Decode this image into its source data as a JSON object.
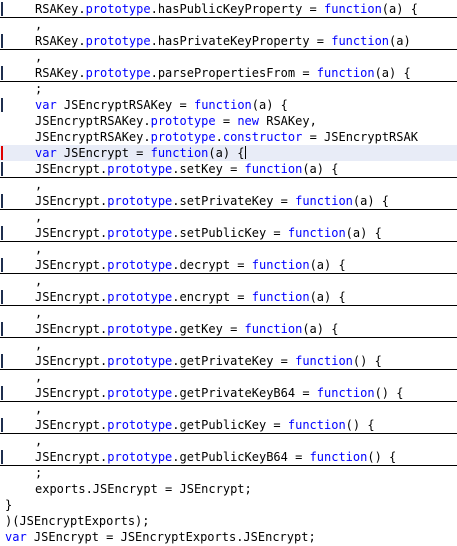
{
  "editor": {
    "lines": [
      {
        "indent": 4,
        "fold": true,
        "gutter": "blue",
        "tokens": [
          {
            "t": "RSAKey.",
            "k": "pl"
          },
          {
            "t": "prototype",
            "k": "kw"
          },
          {
            "t": ".hasPublicKeyProperty = ",
            "k": "pl"
          },
          {
            "t": "function",
            "k": "kw"
          },
          {
            "t": "(a) {",
            "k": "pl"
          }
        ]
      },
      {
        "indent": 4,
        "fold": false,
        "gutter": "",
        "tokens": [
          {
            "t": ",",
            "k": "pl"
          }
        ]
      },
      {
        "indent": 4,
        "fold": true,
        "gutter": "blue",
        "tokens": [
          {
            "t": "RSAKey.",
            "k": "pl"
          },
          {
            "t": "prototype",
            "k": "kw"
          },
          {
            "t": ".hasPrivateKeyProperty = ",
            "k": "pl"
          },
          {
            "t": "function",
            "k": "kw"
          },
          {
            "t": "(a)",
            "k": "pl"
          }
        ]
      },
      {
        "indent": 4,
        "fold": false,
        "gutter": "",
        "tokens": [
          {
            "t": ",",
            "k": "pl"
          }
        ]
      },
      {
        "indent": 4,
        "fold": true,
        "gutter": "blue",
        "tokens": [
          {
            "t": "RSAKey.",
            "k": "pl"
          },
          {
            "t": "prototype",
            "k": "kw"
          },
          {
            "t": ".parsePropertiesFrom = ",
            "k": "pl"
          },
          {
            "t": "function",
            "k": "kw"
          },
          {
            "t": "(a) {",
            "k": "pl"
          }
        ]
      },
      {
        "indent": 4,
        "fold": false,
        "gutter": "",
        "tokens": [
          {
            "t": ";",
            "k": "pl"
          }
        ]
      },
      {
        "indent": 4,
        "fold": false,
        "gutter": "blue",
        "tokens": [
          {
            "t": "var",
            "k": "kw"
          },
          {
            "t": " JSEncryptRSAKey = ",
            "k": "pl"
          },
          {
            "t": "function",
            "k": "kw"
          },
          {
            "t": "(a) {",
            "k": "pl"
          }
        ]
      },
      {
        "indent": 4,
        "fold": false,
        "gutter": "",
        "tokens": [
          {
            "t": "JSEncryptRSAKey.",
            "k": "pl"
          },
          {
            "t": "prototype",
            "k": "kw"
          },
          {
            "t": " = ",
            "k": "pl"
          },
          {
            "t": "new",
            "k": "kw"
          },
          {
            "t": " RSAKey,",
            "k": "pl"
          }
        ]
      },
      {
        "indent": 4,
        "fold": false,
        "gutter": "",
        "tokens": [
          {
            "t": "JSEncryptRSAKey.",
            "k": "pl"
          },
          {
            "t": "prototype",
            "k": "kw"
          },
          {
            "t": ".",
            "k": "pl"
          },
          {
            "t": "constructor",
            "k": "kw"
          },
          {
            "t": " = JSEncryptRSAK",
            "k": "pl"
          }
        ]
      },
      {
        "indent": 4,
        "fold": false,
        "gutter": "red",
        "current": true,
        "tokens": [
          {
            "t": "var",
            "k": "kw"
          },
          {
            "t": " JSEncrypt = ",
            "k": "pl"
          },
          {
            "t": "function",
            "k": "kw"
          },
          {
            "t": "(a) {",
            "k": "pl"
          }
        ]
      },
      {
        "indent": 4,
        "fold": true,
        "gutter": "blue",
        "tokens": [
          {
            "t": "JSEncrypt.",
            "k": "pl"
          },
          {
            "t": "prototype",
            "k": "kw"
          },
          {
            "t": ".setKey = ",
            "k": "pl"
          },
          {
            "t": "function",
            "k": "kw"
          },
          {
            "t": "(a) {",
            "k": "pl"
          }
        ]
      },
      {
        "indent": 4,
        "fold": false,
        "gutter": "",
        "tokens": [
          {
            "t": ",",
            "k": "pl"
          }
        ]
      },
      {
        "indent": 4,
        "fold": true,
        "gutter": "blue",
        "tokens": [
          {
            "t": "JSEncrypt.",
            "k": "pl"
          },
          {
            "t": "prototype",
            "k": "kw"
          },
          {
            "t": ".setPrivateKey = ",
            "k": "pl"
          },
          {
            "t": "function",
            "k": "kw"
          },
          {
            "t": "(a) {",
            "k": "pl"
          }
        ]
      },
      {
        "indent": 4,
        "fold": false,
        "gutter": "",
        "tokens": [
          {
            "t": ",",
            "k": "pl"
          }
        ]
      },
      {
        "indent": 4,
        "fold": true,
        "gutter": "blue",
        "tokens": [
          {
            "t": "JSEncrypt.",
            "k": "pl"
          },
          {
            "t": "prototype",
            "k": "kw"
          },
          {
            "t": ".setPublicKey = ",
            "k": "pl"
          },
          {
            "t": "function",
            "k": "kw"
          },
          {
            "t": "(a) {",
            "k": "pl"
          }
        ]
      },
      {
        "indent": 4,
        "fold": false,
        "gutter": "",
        "tokens": [
          {
            "t": ",",
            "k": "pl"
          }
        ]
      },
      {
        "indent": 4,
        "fold": true,
        "gutter": "blue",
        "tokens": [
          {
            "t": "JSEncrypt.",
            "k": "pl"
          },
          {
            "t": "prototype",
            "k": "kw"
          },
          {
            "t": ".decrypt = ",
            "k": "pl"
          },
          {
            "t": "function",
            "k": "kw"
          },
          {
            "t": "(a) {",
            "k": "pl"
          }
        ]
      },
      {
        "indent": 4,
        "fold": false,
        "gutter": "",
        "tokens": [
          {
            "t": ",",
            "k": "pl"
          }
        ]
      },
      {
        "indent": 4,
        "fold": true,
        "gutter": "blue",
        "tokens": [
          {
            "t": "JSEncrypt.",
            "k": "pl"
          },
          {
            "t": "prototype",
            "k": "kw"
          },
          {
            "t": ".encrypt = ",
            "k": "pl"
          },
          {
            "t": "function",
            "k": "kw"
          },
          {
            "t": "(a) {",
            "k": "pl"
          }
        ]
      },
      {
        "indent": 4,
        "fold": false,
        "gutter": "",
        "tokens": [
          {
            "t": ",",
            "k": "pl"
          }
        ]
      },
      {
        "indent": 4,
        "fold": true,
        "gutter": "blue",
        "tokens": [
          {
            "t": "JSEncrypt.",
            "k": "pl"
          },
          {
            "t": "prototype",
            "k": "kw"
          },
          {
            "t": ".getKey = ",
            "k": "pl"
          },
          {
            "t": "function",
            "k": "kw"
          },
          {
            "t": "(a) {",
            "k": "pl"
          }
        ]
      },
      {
        "indent": 4,
        "fold": false,
        "gutter": "",
        "tokens": [
          {
            "t": ",",
            "k": "pl"
          }
        ]
      },
      {
        "indent": 4,
        "fold": true,
        "gutter": "blue",
        "tokens": [
          {
            "t": "JSEncrypt.",
            "k": "pl"
          },
          {
            "t": "prototype",
            "k": "kw"
          },
          {
            "t": ".getPrivateKey = ",
            "k": "pl"
          },
          {
            "t": "function",
            "k": "kw"
          },
          {
            "t": "() {",
            "k": "pl"
          }
        ]
      },
      {
        "indent": 4,
        "fold": false,
        "gutter": "",
        "tokens": [
          {
            "t": ",",
            "k": "pl"
          }
        ]
      },
      {
        "indent": 4,
        "fold": true,
        "gutter": "blue",
        "tokens": [
          {
            "t": "JSEncrypt.",
            "k": "pl"
          },
          {
            "t": "prototype",
            "k": "kw"
          },
          {
            "t": ".getPrivateKeyB64 = ",
            "k": "pl"
          },
          {
            "t": "function",
            "k": "kw"
          },
          {
            "t": "() {",
            "k": "pl"
          }
        ]
      },
      {
        "indent": 4,
        "fold": false,
        "gutter": "",
        "tokens": [
          {
            "t": ",",
            "k": "pl"
          }
        ]
      },
      {
        "indent": 4,
        "fold": true,
        "gutter": "blue",
        "tokens": [
          {
            "t": "JSEncrypt.",
            "k": "pl"
          },
          {
            "t": "prototype",
            "k": "kw"
          },
          {
            "t": ".getPublicKey = ",
            "k": "pl"
          },
          {
            "t": "function",
            "k": "kw"
          },
          {
            "t": "() {",
            "k": "pl"
          }
        ]
      },
      {
        "indent": 4,
        "fold": false,
        "gutter": "",
        "tokens": [
          {
            "t": ",",
            "k": "pl"
          }
        ]
      },
      {
        "indent": 4,
        "fold": true,
        "gutter": "blue",
        "tokens": [
          {
            "t": "JSEncrypt.",
            "k": "pl"
          },
          {
            "t": "prototype",
            "k": "kw"
          },
          {
            "t": ".getPublicKeyB64 = ",
            "k": "pl"
          },
          {
            "t": "function",
            "k": "kw"
          },
          {
            "t": "() {",
            "k": "pl"
          }
        ]
      },
      {
        "indent": 4,
        "fold": false,
        "gutter": "",
        "tokens": [
          {
            "t": ";",
            "k": "pl"
          }
        ]
      },
      {
        "indent": 4,
        "fold": false,
        "gutter": "",
        "tokens": [
          {
            "t": "exports.JSEncrypt = JSEncrypt;",
            "k": "pl"
          }
        ]
      },
      {
        "indent": 0,
        "fold": false,
        "gutter": "",
        "tokens": [
          {
            "t": "}",
            "k": "pl"
          }
        ]
      },
      {
        "indent": 0,
        "fold": false,
        "gutter": "",
        "tokens": [
          {
            "t": ")(JSEncryptExports);",
            "k": "pl"
          }
        ]
      },
      {
        "indent": 0,
        "fold": false,
        "gutter": "",
        "tokens": [
          {
            "t": "var",
            "k": "kw"
          },
          {
            "t": " JSEncrypt = JSEncryptExports.JSEncrypt;",
            "k": "pl"
          }
        ]
      }
    ]
  }
}
